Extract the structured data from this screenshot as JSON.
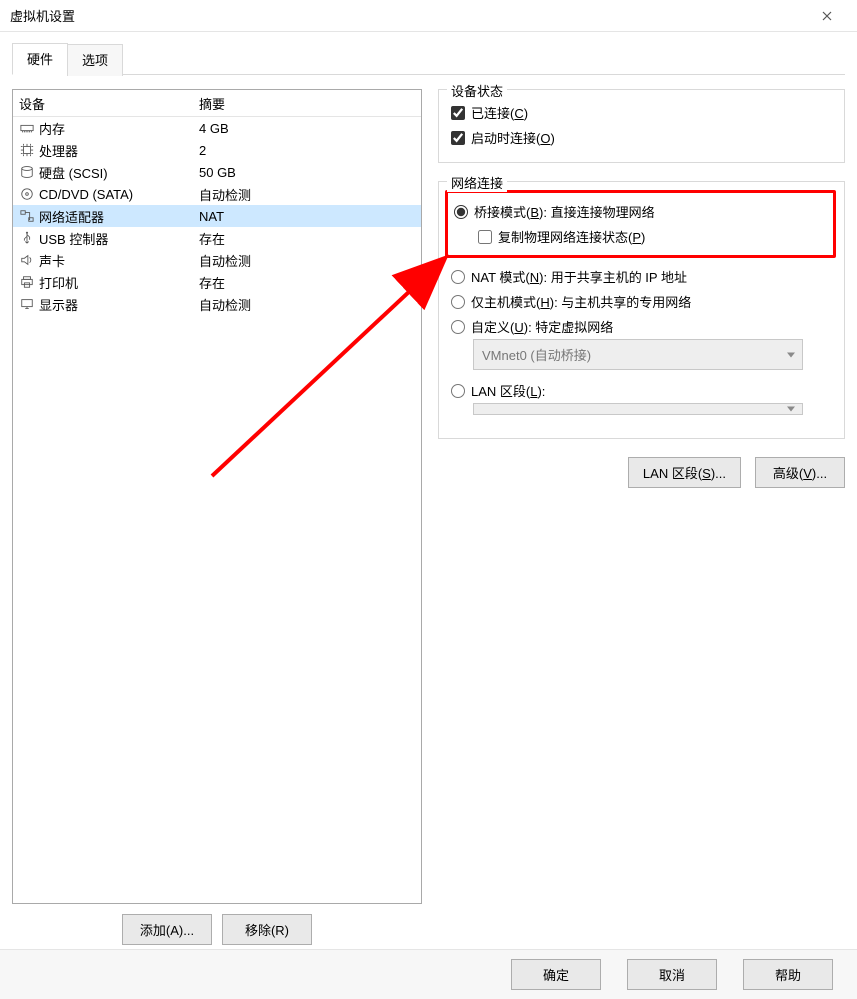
{
  "window": {
    "title": "虚拟机设置"
  },
  "tabs": {
    "hardware": "硬件",
    "options": "选项"
  },
  "device_list": {
    "header_device": "设备",
    "header_summary": "摘要",
    "rows": [
      {
        "icon": "memory",
        "name": "内存",
        "summary": "4 GB"
      },
      {
        "icon": "cpu",
        "name": "处理器",
        "summary": "2"
      },
      {
        "icon": "disk",
        "name": "硬盘 (SCSI)",
        "summary": "50 GB"
      },
      {
        "icon": "disc",
        "name": "CD/DVD (SATA)",
        "summary": "自动检测"
      },
      {
        "icon": "net",
        "name": "网络适配器",
        "summary": "NAT"
      },
      {
        "icon": "usb",
        "name": "USB 控制器",
        "summary": "存在"
      },
      {
        "icon": "sound",
        "name": "声卡",
        "summary": "自动检测"
      },
      {
        "icon": "printer",
        "name": "打印机",
        "summary": "存在"
      },
      {
        "icon": "display",
        "name": "显示器",
        "summary": "自动检测"
      }
    ],
    "selected_index": 4
  },
  "left_buttons": {
    "add": "添加(A)...",
    "remove": "移除(R)"
  },
  "device_state": {
    "legend": "设备状态",
    "connected_label": "已连接(C)",
    "connected_checked": true,
    "connect_at_poweron_label": "启动时连接(O)",
    "connect_at_poweron_checked": true
  },
  "net_connection": {
    "legend": "网络连接",
    "bridged_label": "桥接模式(B): 直接连接物理网络",
    "replicate_label": "复制物理网络连接状态(P)",
    "replicate_checked": false,
    "nat_label": "NAT 模式(N): 用于共享主机的 IP 地址",
    "hostonly_label": "仅主机模式(H): 与主机共享的专用网络",
    "custom_label": "自定义(U): 特定虚拟网络",
    "vmnet_value": "VMnet0 (自动桥接)",
    "lan_label": "LAN 区段(L):",
    "lan_value": "",
    "selected": "bridged"
  },
  "right_buttons": {
    "lan_segments": "LAN 区段(S)...",
    "advanced": "高级(V)..."
  },
  "bottom_buttons": {
    "ok": "确定",
    "cancel": "取消",
    "help": "帮助"
  }
}
